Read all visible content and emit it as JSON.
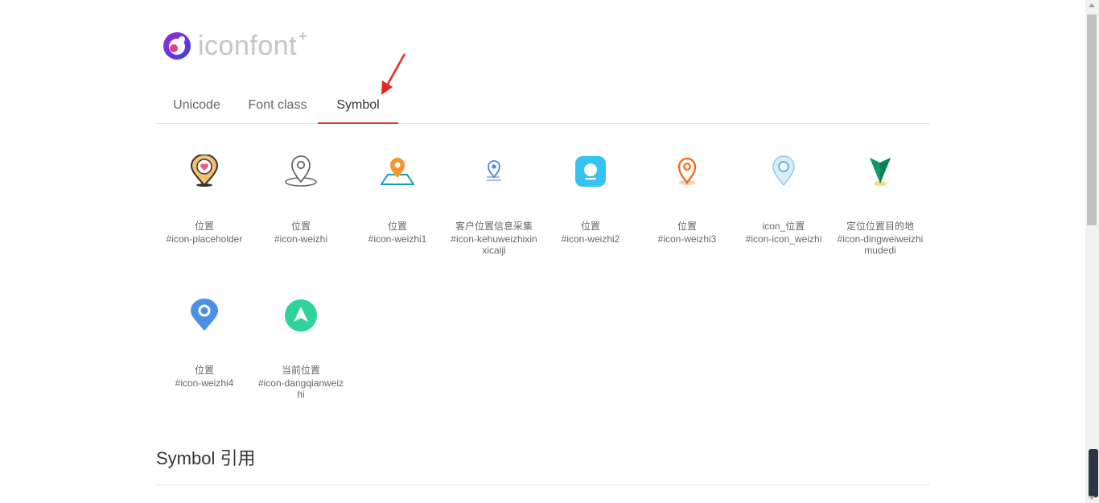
{
  "logo": {
    "icon": "iconfont-logo-icon",
    "text": "iconfont",
    "plus": "+"
  },
  "tabs": [
    {
      "label": "Unicode",
      "active": false
    },
    {
      "label": "Font class",
      "active": false
    },
    {
      "label": "Symbol",
      "active": true
    }
  ],
  "accent_color": "#e4393c",
  "icons": [
    {
      "name": "位置",
      "code": "#icon-placeholder",
      "icon": "heart-pin-icon"
    },
    {
      "name": "位置",
      "code": "#icon-weizhi",
      "icon": "outline-pin-icon"
    },
    {
      "name": "位置",
      "code": "#icon-weizhi1",
      "icon": "map-pin-icon"
    },
    {
      "name": "客户位置信息采集",
      "code": "#icon-kehuweizhixinxicaiji",
      "icon": "small-pin-icon"
    },
    {
      "name": "位置",
      "code": "#icon-weizhi2",
      "icon": "rounded-square-pin-icon"
    },
    {
      "name": "位置",
      "code": "#icon-weizhi3",
      "icon": "orange-pin-icon"
    },
    {
      "name": "icon_位置",
      "code": "#icon-icon_weizhi",
      "icon": "light-blue-pin-icon"
    },
    {
      "name": "定位位置目的地",
      "code": "#icon-dingweiweizhimudedi",
      "icon": "green-arrow-pin-icon"
    },
    {
      "name": "位置",
      "code": "#icon-weizhi4",
      "icon": "blue-pin-icon"
    },
    {
      "name": "当前位置",
      "code": "#icon-dangqianweizhi",
      "icon": "current-location-icon"
    }
  ],
  "section": {
    "title": "Symbol 引用"
  }
}
